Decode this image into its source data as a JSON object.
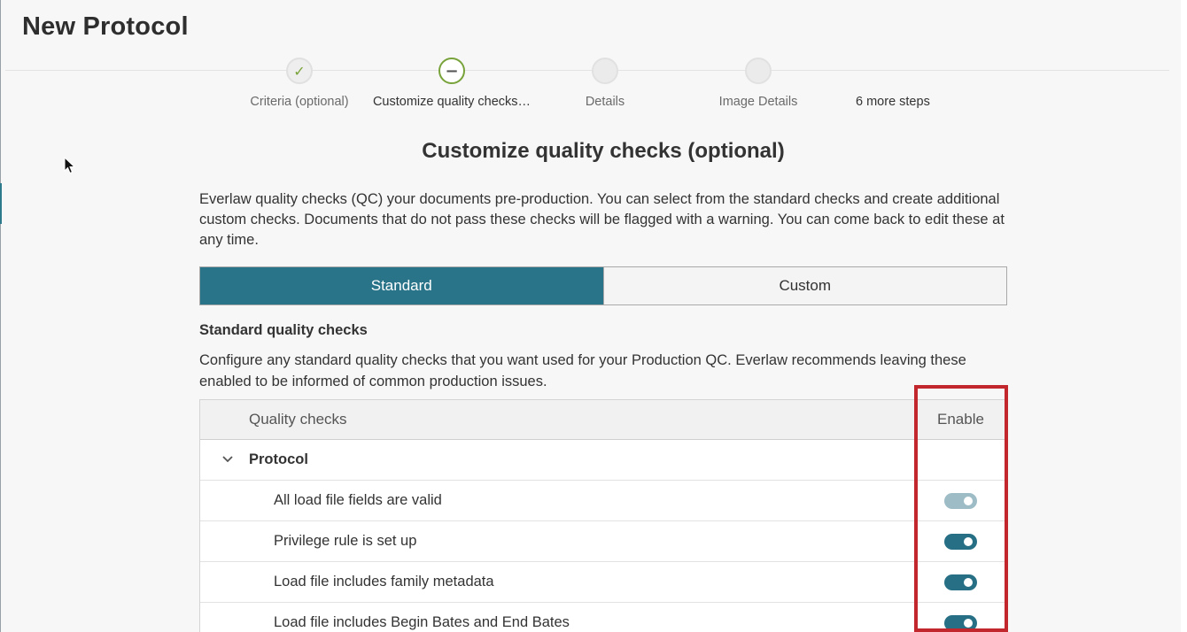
{
  "page": {
    "title": "New Protocol"
  },
  "stepper": {
    "steps": [
      {
        "label": "Criteria (optional)",
        "state": "completed",
        "icon": "checkmark-icon",
        "glyph": "✓"
      },
      {
        "label": "Customize quality checks…",
        "state": "active",
        "icon": "minus-icon",
        "glyph": "−"
      },
      {
        "label": "Details",
        "state": "pending",
        "icon": "",
        "glyph": ""
      },
      {
        "label": "Image Details",
        "state": "pending",
        "icon": "",
        "glyph": ""
      }
    ],
    "more_steps": "6 more steps"
  },
  "section": {
    "title": "Customize quality checks (optional)",
    "intro": "Everlaw quality checks (QC) your documents pre-production. You can select from the standard checks and create additional custom checks. Documents that do not pass these checks will be flagged with a warning. You can come back to edit these at any time."
  },
  "tabs": {
    "standard": "Standard",
    "custom": "Custom",
    "selected": "Standard"
  },
  "standard_checks": {
    "heading": "Standard quality checks",
    "description": "Configure any standard quality checks that you want used for your Production QC. Everlaw recommends leaving these enabled to be informed of common production issues."
  },
  "table": {
    "columns": {
      "name": "Quality checks",
      "enable": "Enable"
    },
    "group": {
      "label": "Protocol",
      "expanded": true,
      "icon": "chevron-down-icon"
    },
    "rows": [
      {
        "label": "All load file fields are valid",
        "enabled": true,
        "toggle_disabled": true
      },
      {
        "label": "Privilege rule is set up",
        "enabled": true,
        "toggle_disabled": false
      },
      {
        "label": "Load file includes family metadata",
        "enabled": true,
        "toggle_disabled": false
      },
      {
        "label": "Load file includes Begin Bates and End Bates",
        "enabled": true,
        "toggle_disabled": false
      }
    ]
  },
  "colors": {
    "accent": "#2a7489",
    "toggle_on": "#266f84",
    "toggle_disabled": "#9dbcc6",
    "step_complete": "#78a23a",
    "highlight": "#c1272d"
  }
}
